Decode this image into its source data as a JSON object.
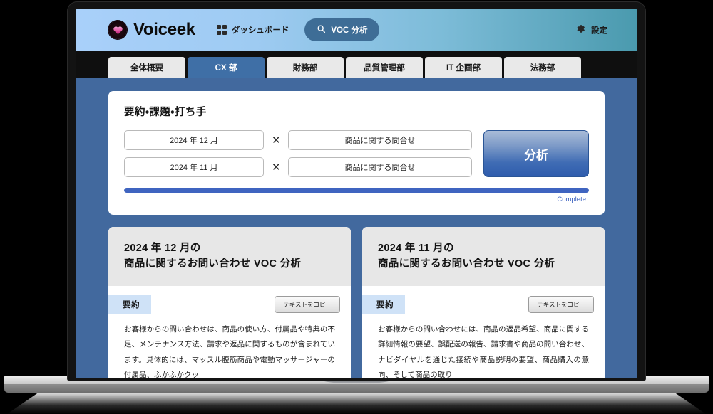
{
  "header": {
    "brand_name": "Voiceek",
    "brand_mark_icon": "heart-in-circle-icon",
    "nav": {
      "dashboard_label": "ダッシュボード",
      "dashboard_icon": "grid-icon",
      "voc_label": "VOC 分析",
      "voc_icon": "search-icon"
    },
    "settings_label": "設定",
    "settings_icon": "gear-icon",
    "colors": {
      "gradient_start": "#a9d0fa",
      "gradient_end": "#4a9aae",
      "voc_button": "#3e6d96"
    }
  },
  "tabs": [
    {
      "label": "全体概要",
      "active": false
    },
    {
      "label": "CX 部",
      "active": true
    },
    {
      "label": "財務部",
      "active": false
    },
    {
      "label": "品質管理部",
      "active": false
    },
    {
      "label": "IT 企画部",
      "active": false
    },
    {
      "label": "法務部",
      "active": false
    }
  ],
  "query_panel": {
    "title": "要約・課題・打ち手",
    "rows": [
      {
        "month": "2024 年 12 月",
        "operator": "✕",
        "topic": "商品に関する問合せ"
      },
      {
        "month": "2024 年 11 月",
        "operator": "✕",
        "topic": "商品に関する問合せ"
      }
    ],
    "analyze_label": "分析",
    "progress": {
      "percent": 100,
      "status_label": "Complete",
      "color": "#3f64c0"
    }
  },
  "results": [
    {
      "title_line1": "2024 年 12 月の",
      "title_line2": "商品に関するお問い合わせ VOC 分析",
      "badge_label": "要約",
      "copy_label": "テキストをコピー",
      "body": "お客様からの問い合わせは、商品の使い方、付属品や特典の不足、メンテナンス方法、請求や返品に関するものが含まれています。具体的には、マッスル腹筋商品や電動マッサージャーの付属品、ふかふかクッ"
    },
    {
      "title_line1": "2024 年 11 月の",
      "title_line2": "商品に関するお問い合わせ VOC 分析",
      "badge_label": "要約",
      "copy_label": "テキストをコピー",
      "body": "お客様からの問い合わせには、商品の返品希望、商品に関する詳細情報の要望、誤配送の報告、請求書や商品の問い合わせ、ナビダイヤルを通じた接続や商品説明の要望、商品購入の意向、そして商品の取り"
    }
  ],
  "canvas": {
    "background": "#42699e"
  }
}
